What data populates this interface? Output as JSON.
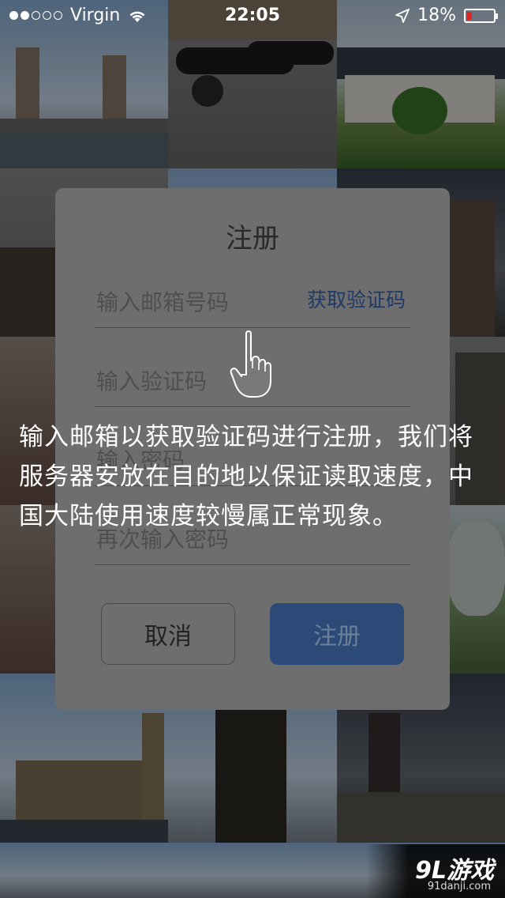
{
  "status_bar": {
    "carrier": "Virgin",
    "time": "22:05",
    "battery_text": "18%",
    "battery_level": 0.18,
    "signal_bars_filled": 2,
    "signal_bars_total": 5
  },
  "dialog": {
    "title": "注册",
    "email_placeholder": "输入邮箱号码",
    "get_code_label": "获取验证码",
    "code_placeholder": "输入验证码",
    "password_placeholder": "输入密码",
    "confirm_placeholder": "再次输入密码",
    "cancel_label": "取消",
    "register_label": "注册"
  },
  "tooltip": {
    "text": "输入邮箱以获取验证码进行注册，我们将服务器安放在目的地以保证读取速度，中国大陆使用速度较慢属正常现象。"
  },
  "watermark": {
    "logo": "9L游戏",
    "site": "91danji.com"
  },
  "colors": {
    "accent_link": "#1e3a66",
    "register_button": "#2c4a78",
    "battery_low": "#e02424"
  }
}
